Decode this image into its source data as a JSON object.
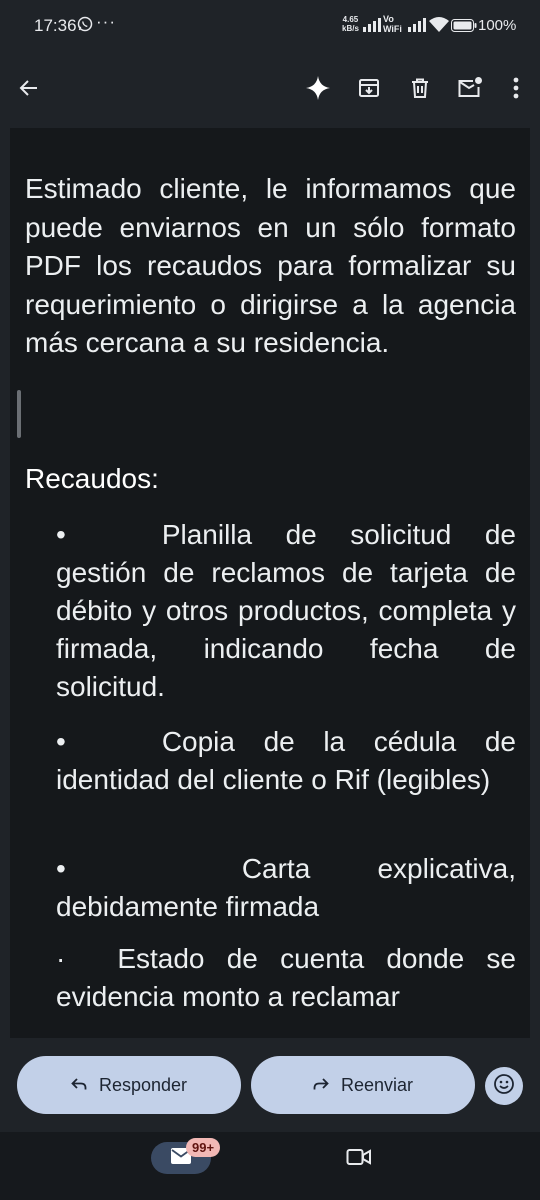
{
  "status_bar": {
    "time": "17:36",
    "more_indicator": "···",
    "speed_value": "4.65",
    "speed_unit": "kB/s",
    "vowifi_top": "Vo",
    "vowifi_bottom": "WiFi",
    "battery": "100%"
  },
  "toolbar": {
    "icons": [
      "back-arrow-icon",
      "sparkle-icon",
      "archive-icon",
      "delete-icon",
      "mark-unread-icon",
      "more-vert-icon"
    ]
  },
  "email": {
    "paragraph": "Estimado cliente, le informamos que puede enviarnos en un sólo formato PDF los recaudos para formalizar su requerimiento o dirigirse a la agencia más cercana a su residencia.",
    "heading": "Recaudos:",
    "bullet_symbol": "•",
    "bullet_symbol_small": "·",
    "items": [
      "Planilla de solicitud de gestión de reclamos de tarjeta de débito y otros productos, completa y firmada, indicando fecha de solicitud.",
      "Copia de la cédula de identidad del cliente o Rif (legibles)",
      "Carta explicativa, debidamente firmada",
      "Estado de cuenta donde se evidencia monto a reclamar"
    ]
  },
  "actions": {
    "reply_label": "Responder",
    "forward_label": "Reenviar"
  },
  "bottom_nav": {
    "mail_badge": "99+"
  },
  "colors": {
    "background": "#1f2328",
    "body_background": "#15181b",
    "pill": "#c2d0e8",
    "badge": "#f2b8b5",
    "mail_nav_active": "#3a4a63"
  }
}
